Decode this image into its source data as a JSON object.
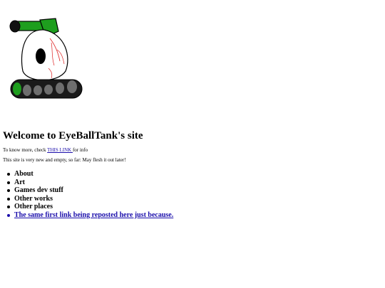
{
  "logo": {
    "icon": "eyeball-tank-icon",
    "colors": {
      "tank_green": "#1e9e1e",
      "tread_dark": "#1a1a1a",
      "tread_wheel": "#6e6e6e",
      "vein_red": "#dd2222"
    }
  },
  "page": {
    "title": "Welcome to EyeBallTank's site",
    "intro_prefix": "To know more, check ",
    "intro_link": "THIS LINK ",
    "intro_suffix": "for info",
    "note": "This site is very new and empty, so far: May flesh it out later!"
  },
  "nav": {
    "items": [
      {
        "label": "About"
      },
      {
        "label": "Art"
      },
      {
        "label": "Games dev stuff"
      },
      {
        "label": "Other works"
      },
      {
        "label": "Other places"
      }
    ],
    "link_item": {
      "label": "The same first link being reposted here just because."
    }
  },
  "colors": {
    "link": "#1a0dab",
    "text": "#000000",
    "background": "#ffffff"
  }
}
